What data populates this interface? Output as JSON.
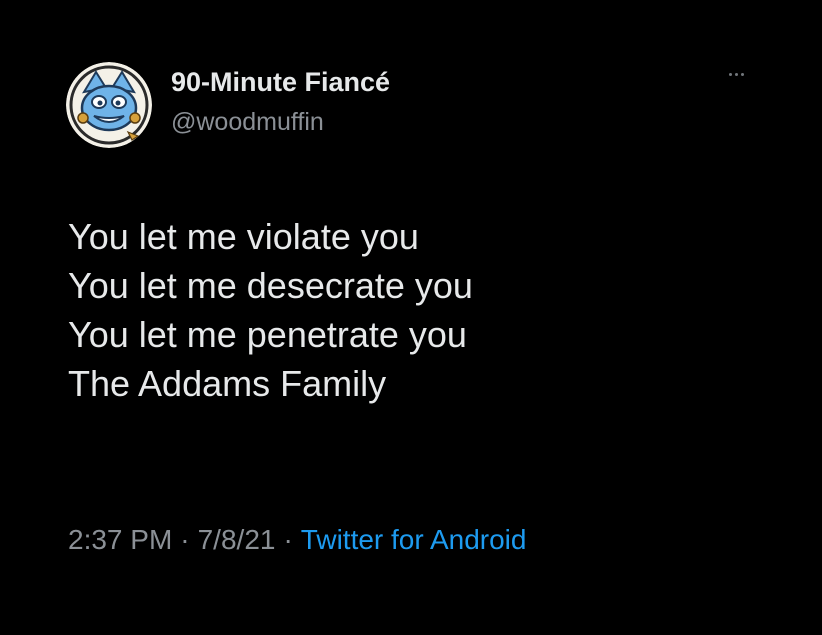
{
  "tweet": {
    "author": {
      "display_name": "90-Minute Fiancé",
      "handle": "@woodmuffin",
      "avatar_icon": "cartoon-character-avatar-icon"
    },
    "more_icon": "more-options-icon",
    "lines": [
      "You let me violate you",
      "You let me desecrate you",
      "You let me penetrate you",
      "The Addams Family"
    ],
    "meta": {
      "time": "2:37 PM",
      "date": "7/8/21",
      "separator": "·",
      "source": "Twitter for Android"
    }
  },
  "colors": {
    "background": "#000000",
    "primary_text": "#e7e9ea",
    "secondary_text": "#8b9096",
    "link": "#1d9bf0"
  }
}
